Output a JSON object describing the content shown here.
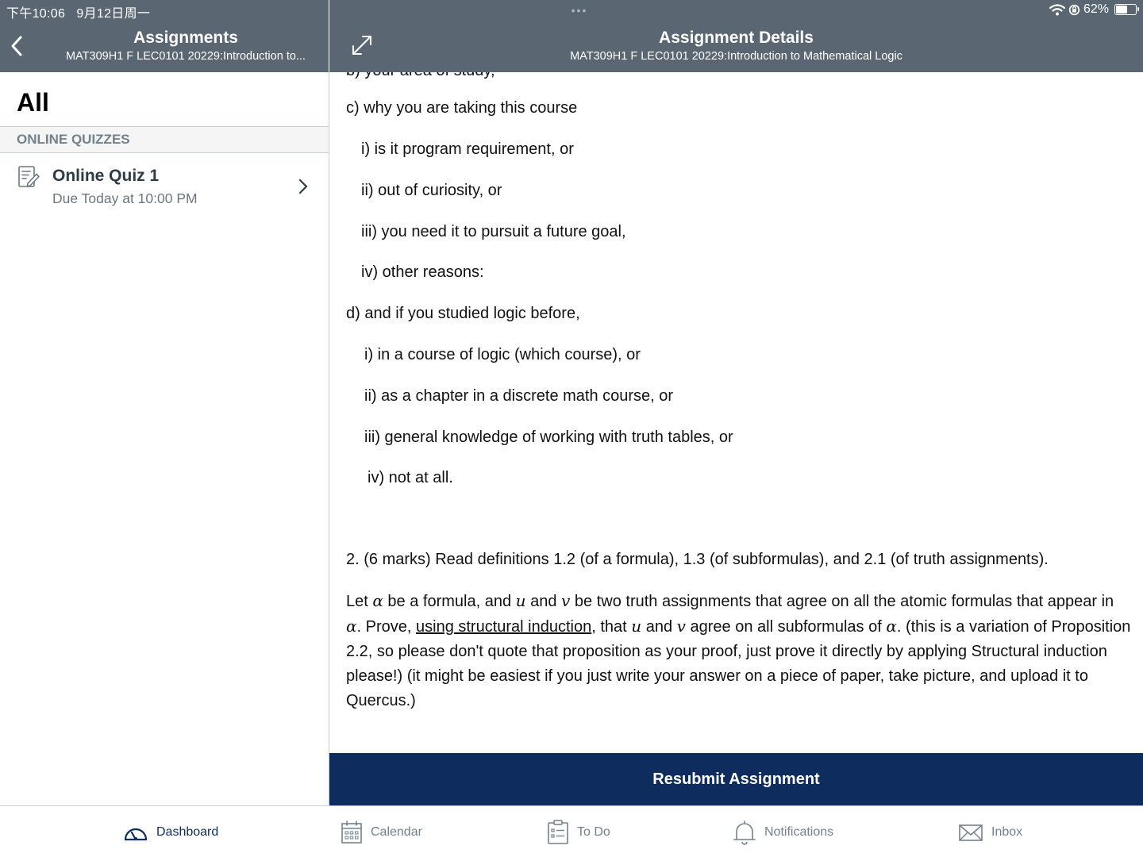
{
  "status_bar": {
    "time": "下午10:06",
    "date": "9月12日周一",
    "battery": "62%",
    "battery_level": 0.62
  },
  "left_header": {
    "title": "Assignments",
    "subtitle": "MAT309H1 F LEC0101 20229:Introduction to..."
  },
  "right_header": {
    "dots": "•••",
    "title": "Assignment Details",
    "subtitle": "MAT309H1 F LEC0101 20229:Introduction to Mathematical Logic"
  },
  "left_panel": {
    "filter_title": "All",
    "section": "ONLINE QUIZZES",
    "items": [
      {
        "title": "Online Quiz 1",
        "due": "Due Today at 10:00 PM"
      }
    ]
  },
  "content": {
    "cut_line": "b) your area of study,",
    "lines": [
      "c) why you are taking this course",
      "i) is it program requirement, or",
      "ii) out of curiosity, or",
      "iii) you need it to pursuit a future goal,",
      "iv) other reasons:",
      "d) and if you studied logic before,",
      "i) in a course of logic (which course), or",
      "ii) as a chapter in a discrete math course, or",
      "iii) general knowledge of working with truth tables, or",
      "iv) not at all."
    ],
    "q2_heading": "2. (6 marks) Read definitions 1.2 (of a formula), 1.3 (of subformulas),  and 2.1 (of truth assignments).",
    "q2_body": {
      "t1": "Let ",
      "alpha": "α",
      "t2": " be a formula, and ",
      "u": "u",
      "t3": " and ",
      "v": "v",
      "t4": " be two truth assignments that agree on all the atomic formulas that appear in ",
      "t5": ".  Prove, ",
      "link": "using structural induction",
      "t6": ",  that ",
      "t7": " and ",
      "t8": " agree on all subformulas of ",
      "t9": ". (this is a variation of Proposition 2.2, so please don't quote that proposition as your proof, just prove it directly by applying Structural induction please!)  (it might be easiest if you just write your answer on a piece of paper, take picture, and upload it to Quercus.)"
    }
  },
  "resubmit_label": "Resubmit Assignment",
  "tabbar": {
    "tabs": [
      {
        "label": "Dashboard",
        "icon": "dashboard-icon",
        "active": true
      },
      {
        "label": "Calendar",
        "icon": "calendar-icon",
        "active": false
      },
      {
        "label": "To Do",
        "icon": "todo-icon",
        "active": false
      },
      {
        "label": "Notifications",
        "icon": "bell-icon",
        "active": false
      },
      {
        "label": "Inbox",
        "icon": "envelope-icon",
        "active": false
      }
    ]
  },
  "colors": {
    "header_bg": "#5a6672",
    "resubmit_bg": "#0e2d5e",
    "active_tab": "#0e2d5e",
    "inactive_tab": "#73818c"
  }
}
